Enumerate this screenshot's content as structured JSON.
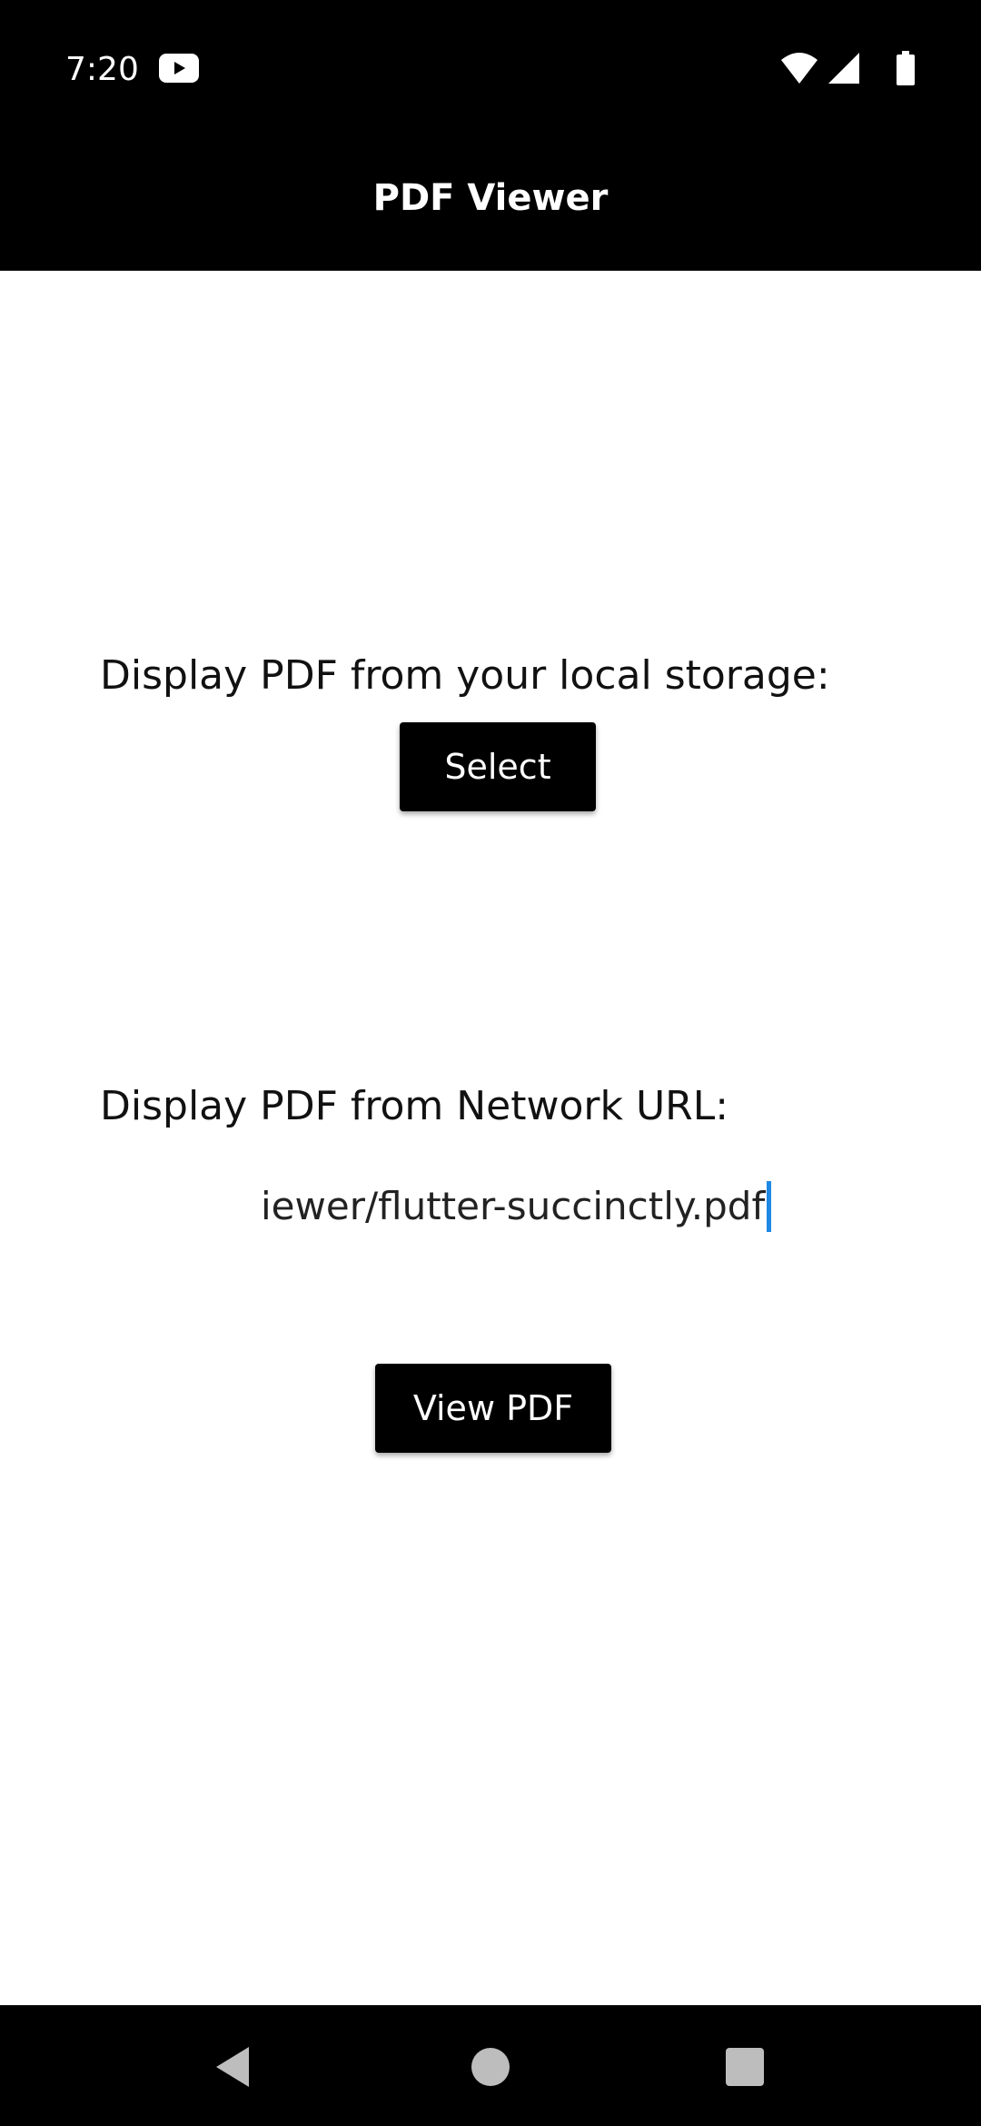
{
  "status_bar": {
    "time": "7:20",
    "app_icon": "youtube-icon",
    "icons": [
      "wifi-icon",
      "signal-icon",
      "battery-icon"
    ]
  },
  "app_bar": {
    "title": "PDF Viewer"
  },
  "local_section": {
    "label": "Display PDF from your local storage:",
    "button_label": "Select"
  },
  "network_section": {
    "label": "Display PDF from Network URL:",
    "url_value": "iewer/flutter-succinctly.pdf",
    "button_label": "View PDF"
  },
  "nav_bar": {
    "icons": [
      "back-icon",
      "home-icon",
      "recents-icon"
    ]
  },
  "colors": {
    "bars": "#000000",
    "background": "#ffffff",
    "button": "#000000",
    "caret": "#1e88e5"
  }
}
